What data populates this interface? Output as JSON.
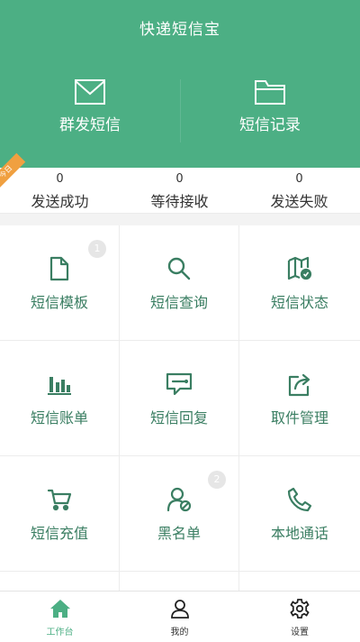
{
  "header": {
    "title": "快递短信宝",
    "actions": [
      {
        "label": "群发短信",
        "icon": "envelope-icon"
      },
      {
        "label": "短信记录",
        "icon": "folder-icon"
      }
    ]
  },
  "stats": {
    "badge": "今日",
    "items": [
      {
        "value": "0",
        "label": "发送成功"
      },
      {
        "value": "0",
        "label": "等待接收"
      },
      {
        "value": "0",
        "label": "发送失败"
      }
    ]
  },
  "grid": [
    {
      "label": "短信模板",
      "icon": "document-icon",
      "badge": "1"
    },
    {
      "label": "短信查询",
      "icon": "search-icon",
      "badge": ""
    },
    {
      "label": "短信状态",
      "icon": "map-status-icon",
      "badge": ""
    },
    {
      "label": "短信账单",
      "icon": "bar-chart-icon",
      "badge": ""
    },
    {
      "label": "短信回复",
      "icon": "reply-message-icon",
      "badge": ""
    },
    {
      "label": "取件管理",
      "icon": "share-export-icon",
      "badge": ""
    },
    {
      "label": "短信充值",
      "icon": "cart-icon",
      "badge": ""
    },
    {
      "label": "黑名单",
      "icon": "user-block-icon",
      "badge": "2"
    },
    {
      "label": "本地通话",
      "icon": "phone-icon",
      "badge": ""
    }
  ],
  "tabbar": [
    {
      "label": "工作台",
      "icon": "home-icon",
      "active": true
    },
    {
      "label": "我的",
      "icon": "user-icon",
      "active": false
    },
    {
      "label": "设置",
      "icon": "gear-icon",
      "active": false
    }
  ],
  "colors": {
    "primary": "#4caf84",
    "accent_text": "#3a7e62",
    "badge": "#f0a040"
  }
}
